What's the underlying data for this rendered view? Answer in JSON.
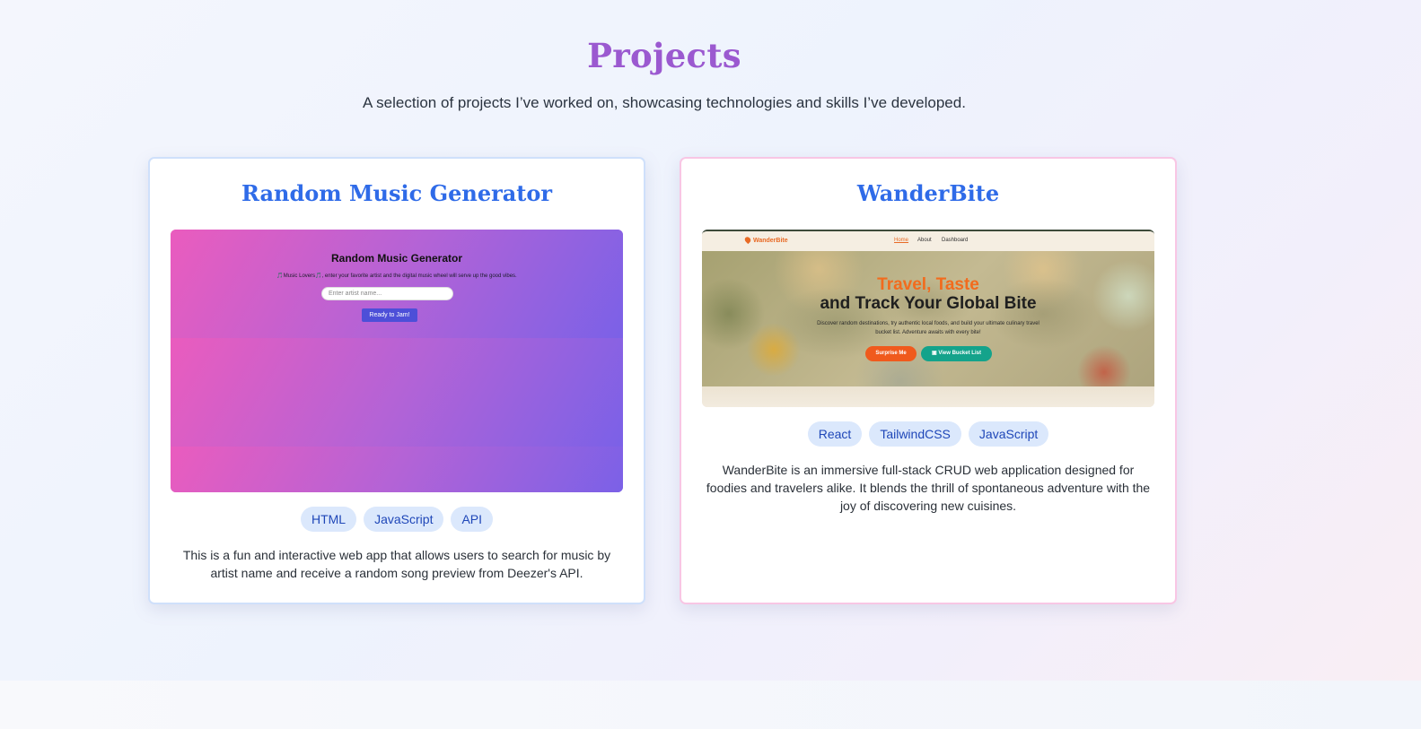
{
  "page": {
    "title": "Projects",
    "subtitle": "A selection of projects I’ve worked on, showcasing technologies and skills I’ve developed."
  },
  "colors": {
    "title": "#9b59d0",
    "card_title": "#2f6be8",
    "tag_bg": "#dbe8fc",
    "tag_text": "#1f47b8",
    "left_card_border": "#cfe0fb",
    "right_card_border": "#f8c6e4"
  },
  "projects": [
    {
      "title": "Random Music Generator",
      "preview": {
        "heading": "Random Music Generator",
        "subtext": "🎵Music Lovers🎵, enter your favorite artist and the digital music wheel will serve up the good vibes.",
        "input_placeholder": "Enter artist name...",
        "button_label": "Ready to Jam!"
      },
      "tags": [
        "HTML",
        "JavaScript",
        "API"
      ],
      "description": "This is a fun and interactive web app that allows users to search for music by artist name and receive a random song preview from Deezer's API."
    },
    {
      "title": "WanderBite",
      "preview": {
        "logo": "WanderBite",
        "nav": [
          "Home",
          "About",
          "Dashboard"
        ],
        "headline_1": "Travel, Taste",
        "headline_2": "and Track Your Global Bite",
        "subtext": "Discover random destinations, try authentic local foods, and build your ultimate culinary travel bucket list. Adventure awaits with every bite!",
        "button_primary": "Surprise Me",
        "button_secondary": "▣ View Bucket List"
      },
      "tags": [
        "React",
        "TailwindCSS",
        "JavaScript"
      ],
      "description": "WanderBite is an immersive full-stack CRUD web application designed for foodies and travelers alike. It blends the thrill of spontaneous adventure with the joy of discovering new cuisines."
    }
  ]
}
